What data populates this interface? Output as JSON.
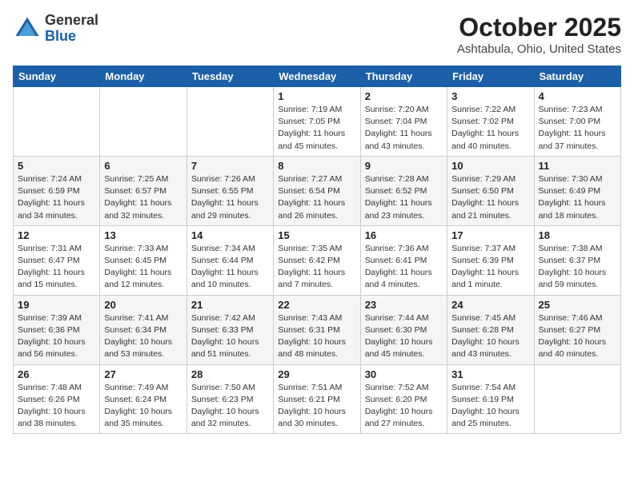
{
  "logo": {
    "general": "General",
    "blue": "Blue"
  },
  "header": {
    "month": "October 2025",
    "location": "Ashtabula, Ohio, United States"
  },
  "days_of_week": [
    "Sunday",
    "Monday",
    "Tuesday",
    "Wednesday",
    "Thursday",
    "Friday",
    "Saturday"
  ],
  "weeks": [
    [
      {
        "day": "",
        "info": ""
      },
      {
        "day": "",
        "info": ""
      },
      {
        "day": "",
        "info": ""
      },
      {
        "day": "1",
        "info": "Sunrise: 7:19 AM\nSunset: 7:05 PM\nDaylight: 11 hours and 45 minutes."
      },
      {
        "day": "2",
        "info": "Sunrise: 7:20 AM\nSunset: 7:04 PM\nDaylight: 11 hours and 43 minutes."
      },
      {
        "day": "3",
        "info": "Sunrise: 7:22 AM\nSunset: 7:02 PM\nDaylight: 11 hours and 40 minutes."
      },
      {
        "day": "4",
        "info": "Sunrise: 7:23 AM\nSunset: 7:00 PM\nDaylight: 11 hours and 37 minutes."
      }
    ],
    [
      {
        "day": "5",
        "info": "Sunrise: 7:24 AM\nSunset: 6:59 PM\nDaylight: 11 hours and 34 minutes."
      },
      {
        "day": "6",
        "info": "Sunrise: 7:25 AM\nSunset: 6:57 PM\nDaylight: 11 hours and 32 minutes."
      },
      {
        "day": "7",
        "info": "Sunrise: 7:26 AM\nSunset: 6:55 PM\nDaylight: 11 hours and 29 minutes."
      },
      {
        "day": "8",
        "info": "Sunrise: 7:27 AM\nSunset: 6:54 PM\nDaylight: 11 hours and 26 minutes."
      },
      {
        "day": "9",
        "info": "Sunrise: 7:28 AM\nSunset: 6:52 PM\nDaylight: 11 hours and 23 minutes."
      },
      {
        "day": "10",
        "info": "Sunrise: 7:29 AM\nSunset: 6:50 PM\nDaylight: 11 hours and 21 minutes."
      },
      {
        "day": "11",
        "info": "Sunrise: 7:30 AM\nSunset: 6:49 PM\nDaylight: 11 hours and 18 minutes."
      }
    ],
    [
      {
        "day": "12",
        "info": "Sunrise: 7:31 AM\nSunset: 6:47 PM\nDaylight: 11 hours and 15 minutes."
      },
      {
        "day": "13",
        "info": "Sunrise: 7:33 AM\nSunset: 6:45 PM\nDaylight: 11 hours and 12 minutes."
      },
      {
        "day": "14",
        "info": "Sunrise: 7:34 AM\nSunset: 6:44 PM\nDaylight: 11 hours and 10 minutes."
      },
      {
        "day": "15",
        "info": "Sunrise: 7:35 AM\nSunset: 6:42 PM\nDaylight: 11 hours and 7 minutes."
      },
      {
        "day": "16",
        "info": "Sunrise: 7:36 AM\nSunset: 6:41 PM\nDaylight: 11 hours and 4 minutes."
      },
      {
        "day": "17",
        "info": "Sunrise: 7:37 AM\nSunset: 6:39 PM\nDaylight: 11 hours and 1 minute."
      },
      {
        "day": "18",
        "info": "Sunrise: 7:38 AM\nSunset: 6:37 PM\nDaylight: 10 hours and 59 minutes."
      }
    ],
    [
      {
        "day": "19",
        "info": "Sunrise: 7:39 AM\nSunset: 6:36 PM\nDaylight: 10 hours and 56 minutes."
      },
      {
        "day": "20",
        "info": "Sunrise: 7:41 AM\nSunset: 6:34 PM\nDaylight: 10 hours and 53 minutes."
      },
      {
        "day": "21",
        "info": "Sunrise: 7:42 AM\nSunset: 6:33 PM\nDaylight: 10 hours and 51 minutes."
      },
      {
        "day": "22",
        "info": "Sunrise: 7:43 AM\nSunset: 6:31 PM\nDaylight: 10 hours and 48 minutes."
      },
      {
        "day": "23",
        "info": "Sunrise: 7:44 AM\nSunset: 6:30 PM\nDaylight: 10 hours and 45 minutes."
      },
      {
        "day": "24",
        "info": "Sunrise: 7:45 AM\nSunset: 6:28 PM\nDaylight: 10 hours and 43 minutes."
      },
      {
        "day": "25",
        "info": "Sunrise: 7:46 AM\nSunset: 6:27 PM\nDaylight: 10 hours and 40 minutes."
      }
    ],
    [
      {
        "day": "26",
        "info": "Sunrise: 7:48 AM\nSunset: 6:26 PM\nDaylight: 10 hours and 38 minutes."
      },
      {
        "day": "27",
        "info": "Sunrise: 7:49 AM\nSunset: 6:24 PM\nDaylight: 10 hours and 35 minutes."
      },
      {
        "day": "28",
        "info": "Sunrise: 7:50 AM\nSunset: 6:23 PM\nDaylight: 10 hours and 32 minutes."
      },
      {
        "day": "29",
        "info": "Sunrise: 7:51 AM\nSunset: 6:21 PM\nDaylight: 10 hours and 30 minutes."
      },
      {
        "day": "30",
        "info": "Sunrise: 7:52 AM\nSunset: 6:20 PM\nDaylight: 10 hours and 27 minutes."
      },
      {
        "day": "31",
        "info": "Sunrise: 7:54 AM\nSunset: 6:19 PM\nDaylight: 10 hours and 25 minutes."
      },
      {
        "day": "",
        "info": ""
      }
    ]
  ]
}
